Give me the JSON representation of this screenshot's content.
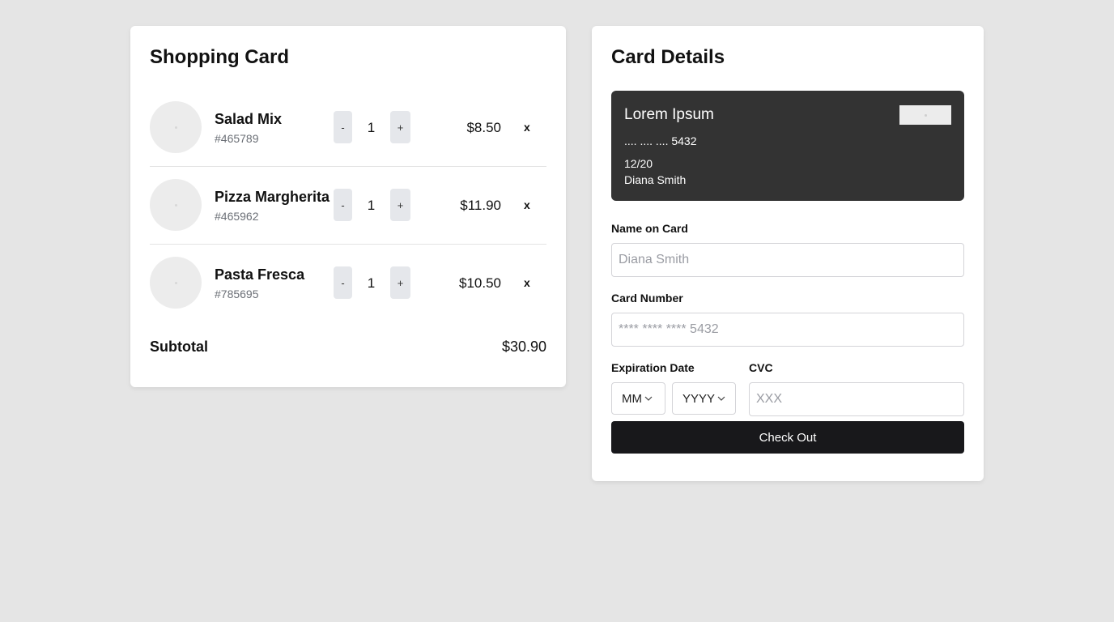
{
  "cart": {
    "title": "Shopping Card",
    "items": [
      {
        "name": "Salad Mix",
        "sku": "#465789",
        "qty": "1",
        "price": "$8.50",
        "minus": "-",
        "plus": "+",
        "remove": "x"
      },
      {
        "name": "Pizza Margherita",
        "sku": "#465962",
        "qty": "1",
        "price": "$11.90",
        "minus": "-",
        "plus": "+",
        "remove": "x"
      },
      {
        "name": "Pasta Fresca",
        "sku": "#785695",
        "qty": "1",
        "price": "$10.50",
        "minus": "-",
        "plus": "+",
        "remove": "x"
      }
    ],
    "subtotal_label": "Subtotal",
    "subtotal_value": "$30.90"
  },
  "details": {
    "title": "Card Details",
    "card": {
      "brand": "Lorem Ipsum",
      "number": ".... .... .... 5432",
      "expiry": "12/20",
      "holder": "Diana Smith"
    },
    "name_label": "Name on Card",
    "name_placeholder": "Diana Smith",
    "number_label": "Card Number",
    "number_placeholder": "**** **** **** 5432",
    "expiration_label": "Expiration Date",
    "month_value": "MM",
    "year_value": "YYYY",
    "cvc_label": "CVC",
    "cvc_placeholder": "XXX",
    "checkout_label": "Check Out"
  },
  "colors": {
    "background": "#e5e5e5",
    "card_dark": "#333333",
    "button_dark": "#18181b",
    "qty_button": "#e5e7eb"
  }
}
